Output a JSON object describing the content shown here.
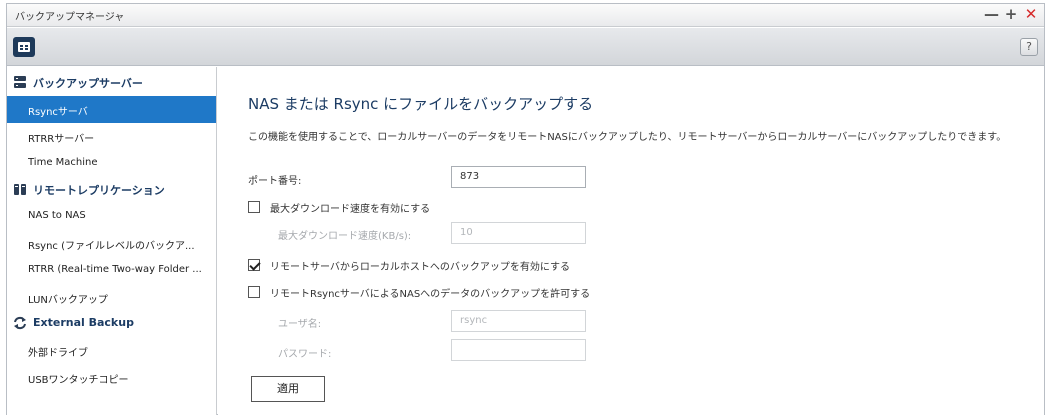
{
  "window": {
    "title": "バックアップマネージャ",
    "controls": {
      "minimize": "—",
      "maximize": "+",
      "close": "✕"
    }
  },
  "toolbar": {
    "menu_icon": "app-menu-icon",
    "help_label": "?"
  },
  "sidebar": {
    "groups": [
      {
        "label": "バックアップサーバー",
        "icon": "server-icon",
        "items": [
          {
            "label": "Rsyncサーバ",
            "active": true
          },
          {
            "label": "RTRRサーバー",
            "active": false
          },
          {
            "label": "Time Machine",
            "active": false
          }
        ]
      },
      {
        "label": "リモートレプリケーション",
        "icon": "replication-icon",
        "items": [
          {
            "label": "NAS to NAS",
            "active": false
          },
          {
            "label": "Rsync (ファイルレベルのバックア...",
            "active": false
          },
          {
            "label": "RTRR (Real-time Two-way Folder ...",
            "active": false
          },
          {
            "label": "LUNバックアップ",
            "active": false
          }
        ]
      },
      {
        "label": "External Backup",
        "icon": "sync-icon",
        "items": [
          {
            "label": "外部ドライブ",
            "active": false
          },
          {
            "label": "USBワンタッチコピー",
            "active": false
          }
        ]
      }
    ]
  },
  "main": {
    "title": "NAS または Rsync にファイルをバックアップする",
    "description": "この機能を使用することで、ローカルサーバーのデータをリモートNASにバックアップしたり、リモートサーバーからローカルサーバーにバックアップしたりできます。",
    "port": {
      "label": "ポート番号:",
      "value": "873"
    },
    "max_download": {
      "checkbox_label": "最大ダウンロード速度を有効にする",
      "checked": false,
      "speed_label": "最大ダウンロード速度(KB/s):",
      "speed_value": "10"
    },
    "remote_to_local": {
      "checkbox_label": "リモートサーバからローカルホストへのバックアップを有効にする",
      "checked": true
    },
    "allow_rsync": {
      "checkbox_label": "リモートRsyncサーバによるNASへのデータのバックアップを許可する",
      "checked": false,
      "username_label": "ユーザ名:",
      "username_value": "rsync",
      "password_label": "パスワード:",
      "password_value": ""
    },
    "apply_label": "適用"
  },
  "colors": {
    "accent": "#1f78c8",
    "title_blue": "#1c3c64",
    "close_red": "#d62b2b"
  }
}
